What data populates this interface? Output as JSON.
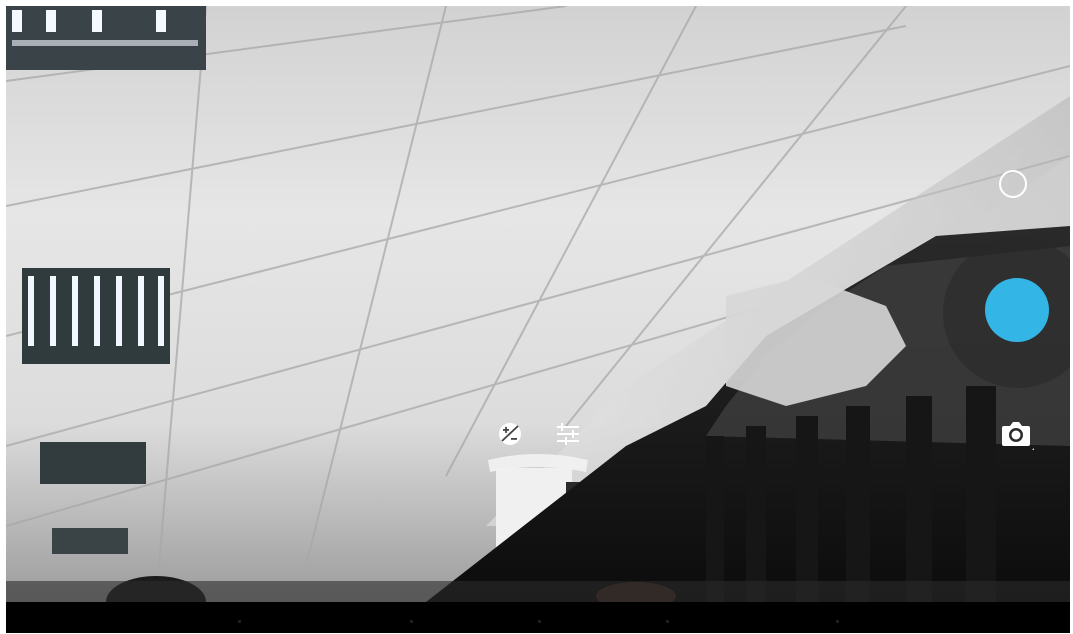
{
  "app": {
    "name": "Camera"
  },
  "viewfinder": {
    "scene": "ceiling-view"
  },
  "controls": {
    "mode_switcher_icon": "circle-outline-icon",
    "shutter_icon": "shutter-button-icon",
    "shutter_color": "#33b5e5",
    "camera_switch_icon": "camera-icon",
    "exposure_icon": "exposure-icon",
    "settings_icon": "tune-sliders-icon",
    "zoom_icon": "zoom-arc-indicator"
  },
  "colors": {
    "accent": "#33b5e5",
    "nav_background": "#000000",
    "icon": "#ffffff"
  }
}
